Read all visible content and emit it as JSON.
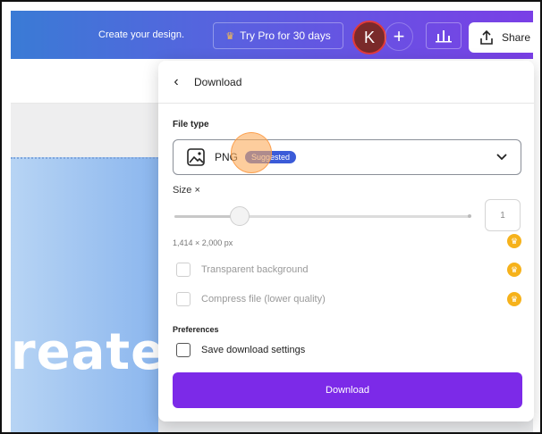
{
  "topbar": {
    "create_text": "Create your design.",
    "try_pro_label": "Try Pro for 30 days",
    "avatar_letter": "K",
    "plus_label": "+",
    "share_label": "Share"
  },
  "canvas": {
    "big_word": "reate"
  },
  "panel": {
    "back_icon": "‹",
    "title": "Download",
    "file_type_label": "File type",
    "file_type_value": "PNG",
    "suggested_badge": "Suggested",
    "size_label": "Size ×",
    "size_value": "1",
    "slider_level": 0.22,
    "dimensions": "1,414 × 2,000 px",
    "transparent_label": "Transparent background",
    "compress_label": "Compress file (lower quality)",
    "preferences_label": "Preferences",
    "save_settings_label": "Save download settings",
    "download_label": "Download"
  },
  "colors": {
    "accent": "#7c2ae8",
    "badge": "#3b5bd8",
    "crown": "#f6b21b"
  },
  "icons": [
    "crown-icon",
    "plus-icon",
    "chart-icon",
    "share-upload-icon",
    "back-chevron-icon",
    "image-icon",
    "chevron-down-icon"
  ]
}
